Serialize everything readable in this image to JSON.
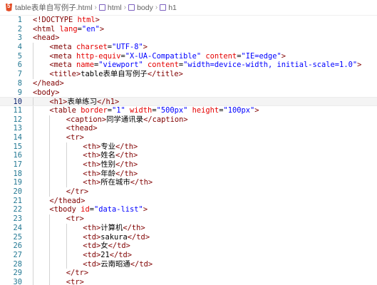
{
  "breadcrumb": [
    {
      "icon": "html5-icon",
      "label": "table表单自写例子.html"
    },
    {
      "icon": "cube-icon",
      "label": "html"
    },
    {
      "icon": "cube-icon",
      "label": "body"
    },
    {
      "icon": "cube-icon",
      "label": "h1"
    }
  ],
  "current_line": 10,
  "lines": [
    {
      "n": "1",
      "indent": 0,
      "tokens": [
        [
          "p",
          "<!"
        ],
        [
          "t",
          "DOCTYPE"
        ],
        [
          "a",
          " html"
        ],
        [
          "p",
          ">"
        ]
      ]
    },
    {
      "n": "2",
      "indent": 0,
      "tokens": [
        [
          "p",
          "<"
        ],
        [
          "t",
          "html"
        ],
        [
          "a",
          " lang"
        ],
        [
          "x",
          "="
        ],
        [
          "v",
          "\"en\""
        ],
        [
          "p",
          ">"
        ]
      ]
    },
    {
      "n": "3",
      "indent": 0,
      "tokens": [
        [
          "p",
          "<"
        ],
        [
          "t",
          "head"
        ],
        [
          "p",
          ">"
        ]
      ]
    },
    {
      "n": "4",
      "indent": 1,
      "tokens": [
        [
          "p",
          "<"
        ],
        [
          "t",
          "meta"
        ],
        [
          "a",
          " charset"
        ],
        [
          "x",
          "="
        ],
        [
          "v",
          "\"UTF-8\""
        ],
        [
          "p",
          ">"
        ]
      ]
    },
    {
      "n": "5",
      "indent": 1,
      "tokens": [
        [
          "p",
          "<"
        ],
        [
          "t",
          "meta"
        ],
        [
          "a",
          " http-equiv"
        ],
        [
          "x",
          "="
        ],
        [
          "v",
          "\"X-UA-Compatible\""
        ],
        [
          "a",
          " content"
        ],
        [
          "x",
          "="
        ],
        [
          "v",
          "\"IE=edge\""
        ],
        [
          "p",
          ">"
        ]
      ]
    },
    {
      "n": "6",
      "indent": 1,
      "tokens": [
        [
          "p",
          "<"
        ],
        [
          "t",
          "meta"
        ],
        [
          "a",
          " name"
        ],
        [
          "x",
          "="
        ],
        [
          "v",
          "\"viewport\""
        ],
        [
          "a",
          " content"
        ],
        [
          "x",
          "="
        ],
        [
          "v",
          "\"width=device-width, initial-scale=1.0\""
        ],
        [
          "p",
          ">"
        ]
      ]
    },
    {
      "n": "7",
      "indent": 1,
      "tokens": [
        [
          "p",
          "<"
        ],
        [
          "t",
          "title"
        ],
        [
          "p",
          ">"
        ],
        [
          "x",
          "table表单自写例子"
        ],
        [
          "p",
          "</"
        ],
        [
          "t",
          "title"
        ],
        [
          "p",
          ">"
        ]
      ]
    },
    {
      "n": "8",
      "indent": 0,
      "tokens": [
        [
          "p",
          "</"
        ],
        [
          "t",
          "head"
        ],
        [
          "p",
          ">"
        ]
      ]
    },
    {
      "n": "9",
      "indent": 0,
      "tokens": [
        [
          "p",
          "<"
        ],
        [
          "t",
          "body"
        ],
        [
          "p",
          ">"
        ]
      ]
    },
    {
      "n": "10",
      "indent": 1,
      "tokens": [
        [
          "p",
          "<"
        ],
        [
          "t",
          "h1"
        ],
        [
          "p",
          ">"
        ],
        [
          "x",
          "表单练习"
        ],
        [
          "p",
          "</"
        ],
        [
          "t",
          "h1"
        ],
        [
          "p",
          ">"
        ]
      ]
    },
    {
      "n": "11",
      "indent": 1,
      "tokens": [
        [
          "p",
          "<"
        ],
        [
          "t",
          "table"
        ],
        [
          "a",
          " border"
        ],
        [
          "x",
          "="
        ],
        [
          "v",
          "\"1\""
        ],
        [
          "a",
          " width"
        ],
        [
          "x",
          "="
        ],
        [
          "v",
          "\"500px\""
        ],
        [
          "a",
          " height"
        ],
        [
          "x",
          "="
        ],
        [
          "v",
          "\"100px\""
        ],
        [
          "p",
          ">"
        ]
      ]
    },
    {
      "n": "12",
      "indent": 2,
      "tokens": [
        [
          "p",
          "<"
        ],
        [
          "t",
          "caption"
        ],
        [
          "p",
          ">"
        ],
        [
          "x",
          "同学通讯录"
        ],
        [
          "p",
          "</"
        ],
        [
          "t",
          "caption"
        ],
        [
          "p",
          ">"
        ]
      ]
    },
    {
      "n": "13",
      "indent": 2,
      "tokens": [
        [
          "p",
          "<"
        ],
        [
          "t",
          "thead"
        ],
        [
          "p",
          ">"
        ]
      ]
    },
    {
      "n": "14",
      "indent": 2,
      "tokens": [
        [
          "p",
          "<"
        ],
        [
          "t",
          "tr"
        ],
        [
          "p",
          ">"
        ]
      ]
    },
    {
      "n": "15",
      "indent": 3,
      "tokens": [
        [
          "p",
          "<"
        ],
        [
          "t",
          "th"
        ],
        [
          "p",
          ">"
        ],
        [
          "x",
          "专业"
        ],
        [
          "p",
          "</"
        ],
        [
          "t",
          "th"
        ],
        [
          "p",
          ">"
        ]
      ]
    },
    {
      "n": "16",
      "indent": 3,
      "tokens": [
        [
          "p",
          "<"
        ],
        [
          "t",
          "th"
        ],
        [
          "p",
          ">"
        ],
        [
          "x",
          "姓名"
        ],
        [
          "p",
          "</"
        ],
        [
          "t",
          "th"
        ],
        [
          "p",
          ">"
        ]
      ]
    },
    {
      "n": "17",
      "indent": 3,
      "tokens": [
        [
          "p",
          "<"
        ],
        [
          "t",
          "th"
        ],
        [
          "p",
          ">"
        ],
        [
          "x",
          "性别"
        ],
        [
          "p",
          "</"
        ],
        [
          "t",
          "th"
        ],
        [
          "p",
          ">"
        ]
      ]
    },
    {
      "n": "18",
      "indent": 3,
      "tokens": [
        [
          "p",
          "<"
        ],
        [
          "t",
          "th"
        ],
        [
          "p",
          ">"
        ],
        [
          "x",
          "年龄"
        ],
        [
          "p",
          "</"
        ],
        [
          "t",
          "th"
        ],
        [
          "p",
          ">"
        ]
      ]
    },
    {
      "n": "19",
      "indent": 3,
      "tokens": [
        [
          "p",
          "<"
        ],
        [
          "t",
          "th"
        ],
        [
          "p",
          ">"
        ],
        [
          "x",
          "所在城市"
        ],
        [
          "p",
          "</"
        ],
        [
          "t",
          "th"
        ],
        [
          "p",
          ">"
        ]
      ]
    },
    {
      "n": "20",
      "indent": 2,
      "tokens": [
        [
          "p",
          "</"
        ],
        [
          "t",
          "tr"
        ],
        [
          "p",
          ">"
        ]
      ]
    },
    {
      "n": "21",
      "indent": 1,
      "tokens": [
        [
          "p",
          "</"
        ],
        [
          "t",
          "thead"
        ],
        [
          "p",
          ">"
        ]
      ]
    },
    {
      "n": "22",
      "indent": 1,
      "tokens": [
        [
          "p",
          "<"
        ],
        [
          "t",
          "tbody"
        ],
        [
          "a",
          " id"
        ],
        [
          "x",
          "="
        ],
        [
          "v",
          "\"data-list\""
        ],
        [
          "p",
          ">"
        ]
      ]
    },
    {
      "n": "23",
      "indent": 2,
      "tokens": [
        [
          "p",
          "<"
        ],
        [
          "t",
          "tr"
        ],
        [
          "p",
          ">"
        ]
      ]
    },
    {
      "n": "24",
      "indent": 3,
      "tokens": [
        [
          "p",
          "<"
        ],
        [
          "t",
          "th"
        ],
        [
          "p",
          ">"
        ],
        [
          "x",
          "计算机"
        ],
        [
          "p",
          "</"
        ],
        [
          "t",
          "th"
        ],
        [
          "p",
          ">"
        ]
      ]
    },
    {
      "n": "25",
      "indent": 3,
      "tokens": [
        [
          "p",
          "<"
        ],
        [
          "t",
          "td"
        ],
        [
          "p",
          ">"
        ],
        [
          "x",
          "sakura"
        ],
        [
          "p",
          "</"
        ],
        [
          "t",
          "td"
        ],
        [
          "p",
          ">"
        ]
      ]
    },
    {
      "n": "26",
      "indent": 3,
      "tokens": [
        [
          "p",
          "<"
        ],
        [
          "t",
          "td"
        ],
        [
          "p",
          ">"
        ],
        [
          "x",
          "女"
        ],
        [
          "p",
          "</"
        ],
        [
          "t",
          "td"
        ],
        [
          "p",
          ">"
        ]
      ]
    },
    {
      "n": "27",
      "indent": 3,
      "tokens": [
        [
          "p",
          "<"
        ],
        [
          "t",
          "td"
        ],
        [
          "p",
          ">"
        ],
        [
          "x",
          "21"
        ],
        [
          "p",
          "</"
        ],
        [
          "t",
          "td"
        ],
        [
          "p",
          ">"
        ]
      ]
    },
    {
      "n": "28",
      "indent": 3,
      "tokens": [
        [
          "p",
          "<"
        ],
        [
          "t",
          "td"
        ],
        [
          "p",
          ">"
        ],
        [
          "x",
          "云南昭通"
        ],
        [
          "p",
          "</"
        ],
        [
          "t",
          "td"
        ],
        [
          "p",
          ">"
        ]
      ]
    },
    {
      "n": "29",
      "indent": 2,
      "tokens": [
        [
          "p",
          "</"
        ],
        [
          "t",
          "tr"
        ],
        [
          "p",
          ">"
        ]
      ]
    },
    {
      "n": "30",
      "indent": 2,
      "tokens": [
        [
          "p",
          "<"
        ],
        [
          "t",
          "tr"
        ],
        [
          "p",
          ">"
        ]
      ]
    }
  ]
}
